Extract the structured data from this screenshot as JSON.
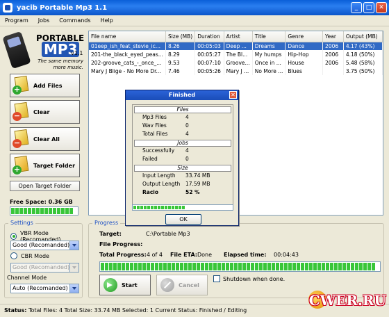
{
  "window": {
    "title": "yacib Portable Mp3 1.1"
  },
  "menu": [
    "Program",
    "Jobs",
    "Commands",
    "Help"
  ],
  "logo": {
    "line1": "PORTABLE",
    "line2": "MP3",
    "version": "v1.1",
    "tagline1": "The same memory",
    "tagline2": "more music."
  },
  "left_buttons": {
    "add": "Add Files",
    "clear": "Clear",
    "clear_all": "Clear All",
    "target": "Target Folder",
    "open_target": "Open Target Folder"
  },
  "free_space": {
    "label": "Free Space: 0.36 GB"
  },
  "settings": {
    "legend": "Settings",
    "vbr_label": "VBR Mode (Recomanded)",
    "vbr_value": "Good (Recomanded)",
    "cbr_label": "CBR Mode",
    "cbr_value": "Good (Recomanded)",
    "channel_label": "Channel Mode",
    "channel_value": "Auto (Recomanded)"
  },
  "table": {
    "columns": [
      "File name",
      "Size (MB)",
      "Duration",
      "Artist",
      "Title",
      "Genre",
      "Year",
      "Output (MB)"
    ],
    "rows": [
      [
        "01eep_ish_feat_stevie_ic...",
        "8.26",
        "00:05:03",
        "Deep ...",
        "Dreams",
        "Dance",
        "2006",
        "4.17 (43%)"
      ],
      [
        "201-the_black_eyed_peas...",
        "8.29",
        "00:05:27",
        "The Bl...",
        "My humps",
        "Hip-Hop",
        "2006",
        "4.18 (50%)"
      ],
      [
        "202-groove_cats_-_once_...",
        "9.53",
        "00:07:10",
        "Groove...",
        "Once in ...",
        "House",
        "2006",
        "5.48 (58%)"
      ],
      [
        "Mary J Blige - No More Dr...",
        "7.46",
        "00:05:26",
        "Mary J ...",
        "No More ...",
        "Blues",
        "",
        "3.75 (50%)"
      ]
    ]
  },
  "dialog": {
    "title": "Finished",
    "files_header": "Files",
    "mp3_label": "Mp3 Files",
    "mp3_value": "4",
    "wav_label": "Wav Files",
    "wav_value": "0",
    "total_label": "Total Files",
    "total_value": "4",
    "jobs_header": "Jobs",
    "success_label": "Successfully",
    "success_value": "4",
    "failed_label": "Failed",
    "failed_value": "0",
    "size_header": "Size",
    "input_label": "Input Length",
    "input_value": "33.74 MB",
    "output_label": "Output Length",
    "output_value": "17.59 MB",
    "racio_label": "Racio",
    "racio_value": "52 %",
    "ok": "OK",
    "progress_fraction": 0.55
  },
  "progress": {
    "legend": "Progress",
    "target_label": "Target:",
    "target_value": "C:\\Portable Mp3",
    "file_progress_label": "File Progress:",
    "total_label": "Total Progress:",
    "total_value": "4 of 4",
    "eta_label": "File ETA:",
    "eta_value": "Done",
    "elapsed_label": "Elapsed time:",
    "elapsed_value": "00:04:43",
    "bar_fraction": 1.0,
    "start": "Start",
    "cancel": "Cancel",
    "shutdown": "Shutdown when done."
  },
  "status": {
    "label": "Status:",
    "text": "Total Files: 4  Total Size: 33.74 MB  Selected: 1  Current Status: Finished / Editing"
  },
  "watermark": {
    "text": "CWER.RU"
  }
}
